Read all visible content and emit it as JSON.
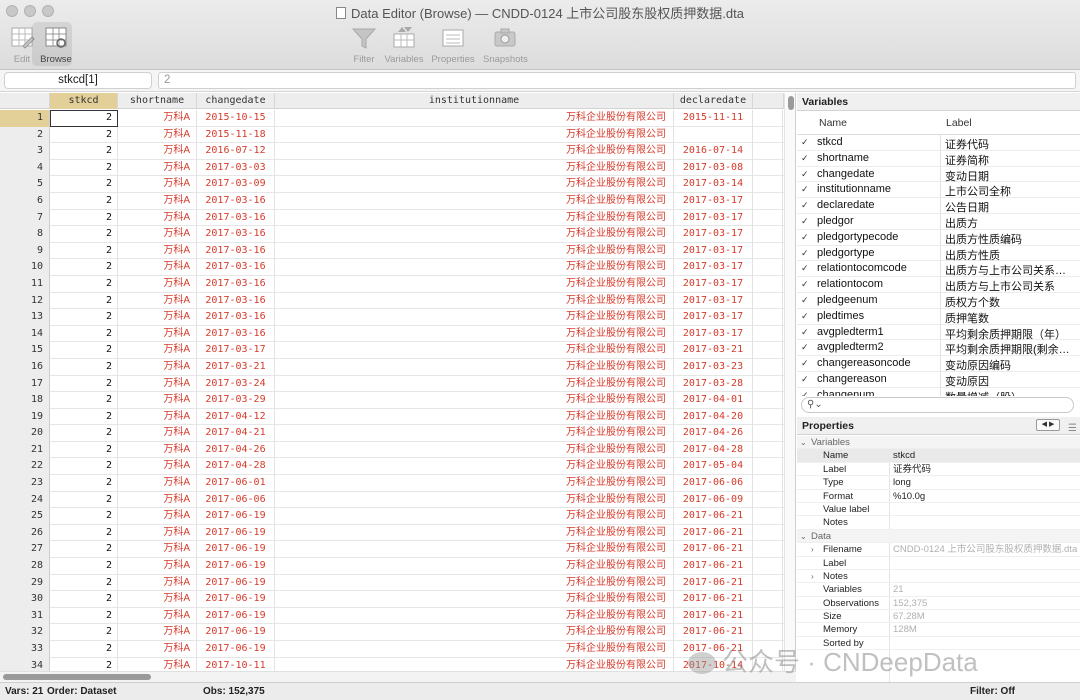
{
  "window": {
    "title": "Data Editor (Browse) — CNDD-0124 上市公司股东股权质押数据.dta"
  },
  "toolbar": {
    "edit": "Edit",
    "browse": "Browse",
    "filter": "Filter",
    "variables": "Variables",
    "properties": "Properties",
    "snapshots": "Snapshots"
  },
  "cellbar": {
    "name": "stkcd[1]",
    "value": "2"
  },
  "columns": [
    "stkcd",
    "shortname",
    "changedate",
    "institutionname",
    "declaredate"
  ],
  "rows": [
    {
      "n": "1",
      "stkcd": "2",
      "sn": "万科A",
      "cd": "2015-10-15",
      "in": "万科企业股份有限公司",
      "dd": "2015-11-11"
    },
    {
      "n": "2",
      "stkcd": "2",
      "sn": "万科A",
      "cd": "2015-11-18",
      "in": "万科企业股份有限公司",
      "dd": ""
    },
    {
      "n": "3",
      "stkcd": "2",
      "sn": "万科A",
      "cd": "2016-07-12",
      "in": "万科企业股份有限公司",
      "dd": "2016-07-14"
    },
    {
      "n": "4",
      "stkcd": "2",
      "sn": "万科A",
      "cd": "2017-03-03",
      "in": "万科企业股份有限公司",
      "dd": "2017-03-08"
    },
    {
      "n": "5",
      "stkcd": "2",
      "sn": "万科A",
      "cd": "2017-03-09",
      "in": "万科企业股份有限公司",
      "dd": "2017-03-14"
    },
    {
      "n": "6",
      "stkcd": "2",
      "sn": "万科A",
      "cd": "2017-03-16",
      "in": "万科企业股份有限公司",
      "dd": "2017-03-17"
    },
    {
      "n": "7",
      "stkcd": "2",
      "sn": "万科A",
      "cd": "2017-03-16",
      "in": "万科企业股份有限公司",
      "dd": "2017-03-17"
    },
    {
      "n": "8",
      "stkcd": "2",
      "sn": "万科A",
      "cd": "2017-03-16",
      "in": "万科企业股份有限公司",
      "dd": "2017-03-17"
    },
    {
      "n": "9",
      "stkcd": "2",
      "sn": "万科A",
      "cd": "2017-03-16",
      "in": "万科企业股份有限公司",
      "dd": "2017-03-17"
    },
    {
      "n": "10",
      "stkcd": "2",
      "sn": "万科A",
      "cd": "2017-03-16",
      "in": "万科企业股份有限公司",
      "dd": "2017-03-17"
    },
    {
      "n": "11",
      "stkcd": "2",
      "sn": "万科A",
      "cd": "2017-03-16",
      "in": "万科企业股份有限公司",
      "dd": "2017-03-17"
    },
    {
      "n": "12",
      "stkcd": "2",
      "sn": "万科A",
      "cd": "2017-03-16",
      "in": "万科企业股份有限公司",
      "dd": "2017-03-17"
    },
    {
      "n": "13",
      "stkcd": "2",
      "sn": "万科A",
      "cd": "2017-03-16",
      "in": "万科企业股份有限公司",
      "dd": "2017-03-17"
    },
    {
      "n": "14",
      "stkcd": "2",
      "sn": "万科A",
      "cd": "2017-03-16",
      "in": "万科企业股份有限公司",
      "dd": "2017-03-17"
    },
    {
      "n": "15",
      "stkcd": "2",
      "sn": "万科A",
      "cd": "2017-03-17",
      "in": "万科企业股份有限公司",
      "dd": "2017-03-21"
    },
    {
      "n": "16",
      "stkcd": "2",
      "sn": "万科A",
      "cd": "2017-03-21",
      "in": "万科企业股份有限公司",
      "dd": "2017-03-23"
    },
    {
      "n": "17",
      "stkcd": "2",
      "sn": "万科A",
      "cd": "2017-03-24",
      "in": "万科企业股份有限公司",
      "dd": "2017-03-28"
    },
    {
      "n": "18",
      "stkcd": "2",
      "sn": "万科A",
      "cd": "2017-03-29",
      "in": "万科企业股份有限公司",
      "dd": "2017-04-01"
    },
    {
      "n": "19",
      "stkcd": "2",
      "sn": "万科A",
      "cd": "2017-04-12",
      "in": "万科企业股份有限公司",
      "dd": "2017-04-20"
    },
    {
      "n": "20",
      "stkcd": "2",
      "sn": "万科A",
      "cd": "2017-04-21",
      "in": "万科企业股份有限公司",
      "dd": "2017-04-26"
    },
    {
      "n": "21",
      "stkcd": "2",
      "sn": "万科A",
      "cd": "2017-04-26",
      "in": "万科企业股份有限公司",
      "dd": "2017-04-28"
    },
    {
      "n": "22",
      "stkcd": "2",
      "sn": "万科A",
      "cd": "2017-04-28",
      "in": "万科企业股份有限公司",
      "dd": "2017-05-04"
    },
    {
      "n": "23",
      "stkcd": "2",
      "sn": "万科A",
      "cd": "2017-06-01",
      "in": "万科企业股份有限公司",
      "dd": "2017-06-06"
    },
    {
      "n": "24",
      "stkcd": "2",
      "sn": "万科A",
      "cd": "2017-06-06",
      "in": "万科企业股份有限公司",
      "dd": "2017-06-09"
    },
    {
      "n": "25",
      "stkcd": "2",
      "sn": "万科A",
      "cd": "2017-06-19",
      "in": "万科企业股份有限公司",
      "dd": "2017-06-21"
    },
    {
      "n": "26",
      "stkcd": "2",
      "sn": "万科A",
      "cd": "2017-06-19",
      "in": "万科企业股份有限公司",
      "dd": "2017-06-21"
    },
    {
      "n": "27",
      "stkcd": "2",
      "sn": "万科A",
      "cd": "2017-06-19",
      "in": "万科企业股份有限公司",
      "dd": "2017-06-21"
    },
    {
      "n": "28",
      "stkcd": "2",
      "sn": "万科A",
      "cd": "2017-06-19",
      "in": "万科企业股份有限公司",
      "dd": "2017-06-21"
    },
    {
      "n": "29",
      "stkcd": "2",
      "sn": "万科A",
      "cd": "2017-06-19",
      "in": "万科企业股份有限公司",
      "dd": "2017-06-21"
    },
    {
      "n": "30",
      "stkcd": "2",
      "sn": "万科A",
      "cd": "2017-06-19",
      "in": "万科企业股份有限公司",
      "dd": "2017-06-21"
    },
    {
      "n": "31",
      "stkcd": "2",
      "sn": "万科A",
      "cd": "2017-06-19",
      "in": "万科企业股份有限公司",
      "dd": "2017-06-21"
    },
    {
      "n": "32",
      "stkcd": "2",
      "sn": "万科A",
      "cd": "2017-06-19",
      "in": "万科企业股份有限公司",
      "dd": "2017-06-21"
    },
    {
      "n": "33",
      "stkcd": "2",
      "sn": "万科A",
      "cd": "2017-06-19",
      "in": "万科企业股份有限公司",
      "dd": "2017-06-21"
    },
    {
      "n": "34",
      "stkcd": "2",
      "sn": "万科A",
      "cd": "2017-10-11",
      "in": "万科企业股份有限公司",
      "dd": "2017-10-14"
    }
  ],
  "variables_panel": {
    "title": "Variables",
    "col_name": "Name",
    "col_label": "Label",
    "items": [
      {
        "name": "stkcd",
        "label": "证券代码"
      },
      {
        "name": "shortname",
        "label": "证券简称"
      },
      {
        "name": "changedate",
        "label": "变动日期"
      },
      {
        "name": "institutionname",
        "label": "上市公司全称"
      },
      {
        "name": "declaredate",
        "label": "公告日期"
      },
      {
        "name": "pledgor",
        "label": "出质方"
      },
      {
        "name": "pledgortypecode",
        "label": "出质方性质编码"
      },
      {
        "name": "pledgortype",
        "label": "出质方性质"
      },
      {
        "name": "relationtocomcode",
        "label": "出质方与上市公司关系…"
      },
      {
        "name": "relationtocom",
        "label": "出质方与上市公司关系"
      },
      {
        "name": "pledgeenum",
        "label": "质权方个数"
      },
      {
        "name": "pledtimes",
        "label": "质押笔数"
      },
      {
        "name": "avgpledterm1",
        "label": "平均剩余质押期限（年）"
      },
      {
        "name": "avgpledterm2",
        "label": "平均剩余质押期限(剩余…"
      },
      {
        "name": "changereasoncode",
        "label": "变动原因编码"
      },
      {
        "name": "changereason",
        "label": "变动原因"
      },
      {
        "name": "changenum",
        "label": "数量增减（股）"
      }
    ]
  },
  "properties_panel": {
    "title": "Properties",
    "nav": "◀ ▶",
    "variables_section": "Variables",
    "var_props": [
      {
        "k": "Name",
        "v": "stkcd"
      },
      {
        "k": "Label",
        "v": "证券代码"
      },
      {
        "k": "Type",
        "v": "long"
      },
      {
        "k": "Format",
        "v": "%10.0g"
      },
      {
        "k": "Value label",
        "v": ""
      },
      {
        "k": "Notes",
        "v": ""
      }
    ],
    "data_section": "Data",
    "data_props": [
      {
        "k": "Filename",
        "v": "CNDD-0124 上市公司股东股权质押数据.dta"
      },
      {
        "k": "Label",
        "v": ""
      },
      {
        "k": "Notes",
        "v": ""
      },
      {
        "k": "Variables",
        "v": "21"
      },
      {
        "k": "Observations",
        "v": "152,375"
      },
      {
        "k": "Size",
        "v": "67.28M"
      },
      {
        "k": "Memory",
        "v": "128M"
      },
      {
        "k": "Sorted by",
        "v": ""
      }
    ]
  },
  "status": {
    "vars": "Vars: 21",
    "order": "Order: Dataset",
    "obs": "Obs: 152,375",
    "filter": "Filter: Off"
  },
  "watermark": "公众号 · CNDeepData"
}
